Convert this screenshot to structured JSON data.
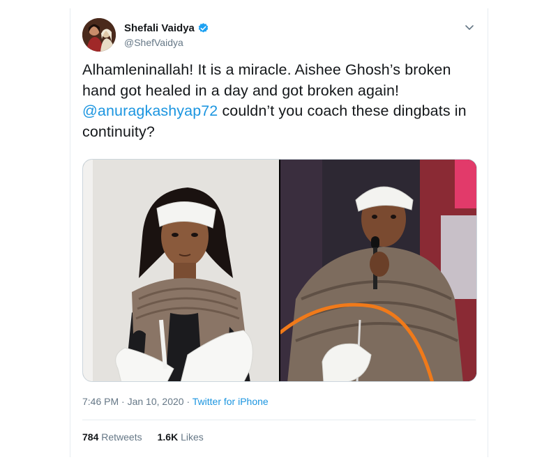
{
  "author": {
    "name": "Shefali Vaidya",
    "handle": "@ShefVaidya",
    "verified_icon": "verified-badge-icon",
    "accent": "#1da1f2"
  },
  "tweet": {
    "text_before": "Alhamleninallah! It is a miracle. Aishee Ghosh’s broken hand got healed in a day and got broken again! ",
    "mention": "@anuragkashyap72",
    "text_after": " couldn’t you coach these dingbats in continuity?"
  },
  "media": {
    "images": [
      {
        "label": "left-photo",
        "description_icon": "photo"
      },
      {
        "label": "right-photo",
        "description_icon": "photo"
      }
    ]
  },
  "meta": {
    "time": "7:46 PM",
    "date": "Jan 10, 2020",
    "separator": "·",
    "source": "Twitter for iPhone"
  },
  "stats": {
    "retweets_count": "784",
    "retweets_label": "Retweets",
    "likes_count": "1.6K",
    "likes_label": "Likes"
  },
  "colors": {
    "link": "#1b95e0",
    "muted": "#657786",
    "border": "#e6ecf0"
  }
}
